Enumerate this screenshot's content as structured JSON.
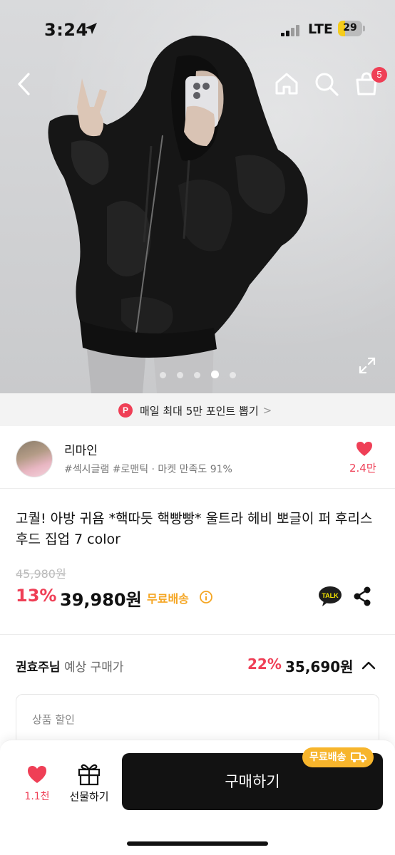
{
  "status_bar": {
    "time": "3:24",
    "network": "LTE",
    "battery": "29",
    "battery_level": 0.29
  },
  "header": {
    "cart_count": "5"
  },
  "gallery": {
    "total": 5,
    "active_index": 3
  },
  "point_banner": {
    "badge": "P",
    "text": "매일 최대 5만 포인트 뽑기",
    "chevron": ">"
  },
  "seller": {
    "name": "리마인",
    "tags": "#섹시글램 #로맨틱 · 마켓 만족도 91%",
    "like_count": "2.4만"
  },
  "product": {
    "title": "고퀄! 아방 귀욤 *핵따듯 핵빵빵* 울트라 헤비 뽀글이 퍼 후리스 후드 집업 7 color",
    "original_price": "45,980원",
    "discount": "13%",
    "price": "39,980원",
    "free_shipping": "무료배송",
    "talk_label": "TALK"
  },
  "expected": {
    "user": "권효주님",
    "label": "예상 구매가",
    "discount": "22%",
    "price": "35,690원",
    "box_label": "상품 할인"
  },
  "bottom_bar": {
    "wish_count": "1.1천",
    "gift_label": "선물하기",
    "buy_label": "구매하기",
    "free_shipping_pill": "무료배송"
  },
  "colors": {
    "accent_red": "#ef3f56",
    "free_ship_orange": "#f5a623",
    "buy_black": "#121212"
  }
}
